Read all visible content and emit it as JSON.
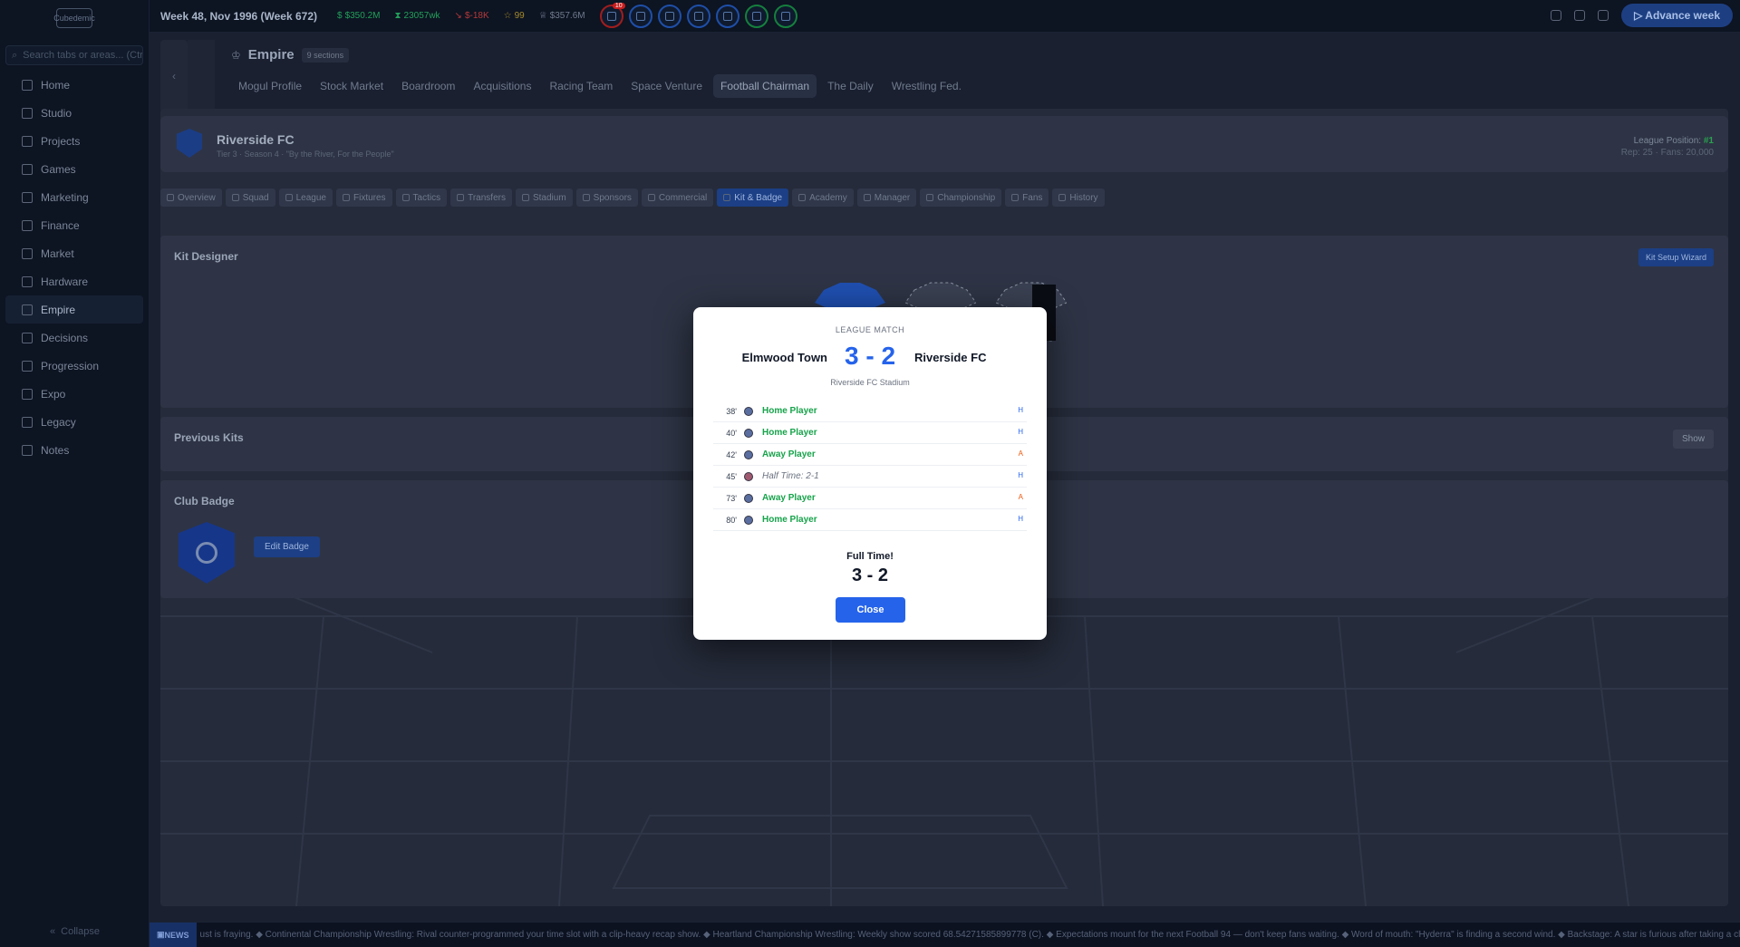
{
  "sidebar": {
    "logo_text": "Cubedemic",
    "search_placeholder": "Search tabs or areas... (Ctrl",
    "items": [
      {
        "label": "Home",
        "icon": "home-icon"
      },
      {
        "label": "Studio",
        "icon": "building-icon"
      },
      {
        "label": "Projects",
        "icon": "folder-icon"
      },
      {
        "label": "Games",
        "icon": "gamepad-icon"
      },
      {
        "label": "Marketing",
        "icon": "megaphone-icon"
      },
      {
        "label": "Finance",
        "icon": "bank-icon"
      },
      {
        "label": "Market",
        "icon": "globe-icon"
      },
      {
        "label": "Hardware",
        "icon": "cpu-icon"
      },
      {
        "label": "Empire",
        "icon": "crown-icon"
      },
      {
        "label": "Decisions",
        "icon": "warning-icon"
      },
      {
        "label": "Progression",
        "icon": "trophy-icon"
      },
      {
        "label": "Expo",
        "icon": "monitor-icon"
      },
      {
        "label": "Legacy",
        "icon": "book-icon"
      },
      {
        "label": "Notes",
        "icon": "notes-icon"
      }
    ],
    "active_item": "Empire",
    "collapse_label": "Collapse"
  },
  "topbar": {
    "week": "Week 48, Nov 1996 (Week 672)",
    "cash": "$350.2M",
    "weekly": "23057wk",
    "loss": "$-18K",
    "fame": "99",
    "value": "$357.6M",
    "notification_count": "10",
    "advance_label": "Advance week"
  },
  "header": {
    "title": "Empire",
    "sections_badge": "9 sections",
    "subtabs": [
      "Mogul Profile",
      "Stock Market",
      "Boardroom",
      "Acquisitions",
      "Racing Team",
      "Space Venture",
      "Football Chairman",
      "The Daily",
      "Wrestling Fed."
    ],
    "active_subtab": "Football Chairman"
  },
  "club": {
    "name": "Riverside FC",
    "subtitle": "Tier 3 · Season 4 · \"By the River, For the People\"",
    "league_position_label": "League Position:",
    "league_position": "#1",
    "rep_fans": "Rep: 25 · Fans: 20,000"
  },
  "tabs": [
    "Overview",
    "Squad",
    "League",
    "Fixtures",
    "Tactics",
    "Transfers",
    "Stadium",
    "Sponsors",
    "Commercial",
    "Kit & Badge",
    "Academy",
    "Manager",
    "Championship",
    "Fans",
    "History"
  ],
  "active_tab": "Kit & Badge",
  "kit_designer": {
    "title": "Kit Designer",
    "wizard_label": "Kit Setup Wizard"
  },
  "previous_kits": {
    "title": "Previous Kits",
    "show_label": "Show"
  },
  "club_badge": {
    "title": "Club Badge",
    "edit_label": "Edit Badge"
  },
  "ticker": {
    "tag": "NEWS",
    "text": "ust is fraying. ◆ Continental Championship Wrestling: Rival counter-programmed your time slot with a clip-heavy recap show. ◆ Heartland Championship Wrestling: Weekly show scored 68.54271585899778 (C). ◆ Expectations mount for the next Football 94 — don't keep fans waiting. ◆ Word of mouth: \"Hyderra\" is finding a second wind. ◆ Backstage: A star is furious after taking a clean l"
  },
  "match": {
    "label": "LEAGUE MATCH",
    "home": "Elmwood Town",
    "score": "3 - 2",
    "away": "Riverside FC",
    "venue": "Riverside FC Stadium",
    "events": [
      {
        "minute": "38'",
        "text": "Home Player",
        "side": "H",
        "type": "goal"
      },
      {
        "minute": "40'",
        "text": "Home Player",
        "side": "H",
        "type": "goal"
      },
      {
        "minute": "42'",
        "text": "Away Player",
        "side": "A",
        "type": "goal"
      },
      {
        "minute": "45'",
        "text": "Half Time: 2-1",
        "side": "H",
        "type": "halftime"
      },
      {
        "minute": "73'",
        "text": "Away Player",
        "side": "A",
        "type": "goal"
      },
      {
        "minute": "80'",
        "text": "Home Player",
        "side": "H",
        "type": "goal"
      }
    ],
    "full_time_label": "Full Time!",
    "full_time_score": "3 - 2",
    "close_label": "Close"
  }
}
